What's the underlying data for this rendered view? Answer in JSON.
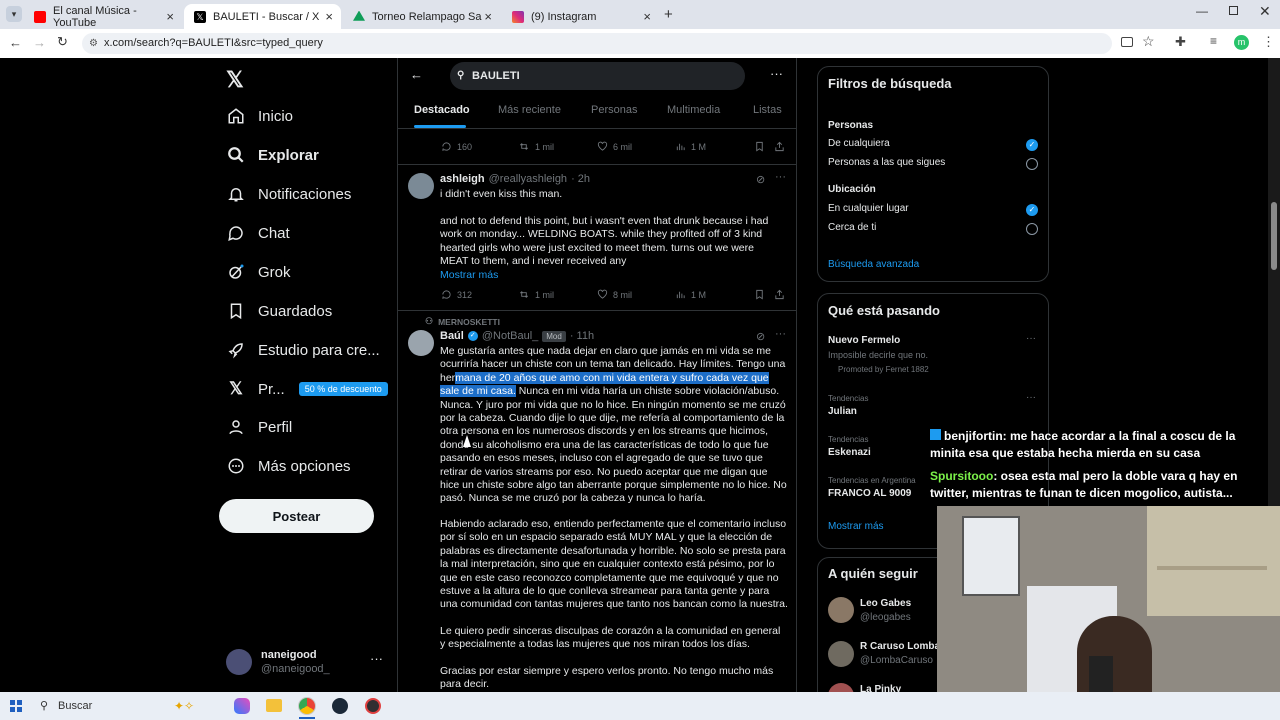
{
  "browser": {
    "tabs": [
      {
        "label": "El canal Música - YouTube",
        "color": "#ff0000"
      },
      {
        "label": "BAULETI - Buscar / X",
        "color": "#000000"
      },
      {
        "label": "Torneo Relampago Sanzi - Goo",
        "color": "#0f9d58"
      },
      {
        "label": "(9) Instagram",
        "color": "#e1306c"
      }
    ],
    "url": "x.com/search?q=BAULETI&src=typed_query",
    "profile_initial": "m"
  },
  "nav": {
    "items": [
      {
        "label": "Inicio",
        "icon": "home-icon"
      },
      {
        "label": "Explorar",
        "icon": "search-icon"
      },
      {
        "label": "Notificaciones",
        "icon": "bell-icon"
      },
      {
        "label": "Chat",
        "icon": "chat-icon"
      },
      {
        "label": "Grok",
        "icon": "grok-icon"
      },
      {
        "label": "Guardados",
        "icon": "bookmark-icon"
      },
      {
        "label": "Estudio para cre...",
        "icon": "rocket-icon"
      },
      {
        "label": "Pr...",
        "icon": "x-icon"
      },
      {
        "label": "Perfil",
        "icon": "person-icon"
      },
      {
        "label": "Más opciones",
        "icon": "more-circle-icon"
      }
    ],
    "premium_badge": "50 % de descuento",
    "post_button": "Postear",
    "account": {
      "name": "naneigood",
      "handle": "@naneigood_"
    }
  },
  "search": {
    "query": "BAULETI",
    "tabs": [
      "Destacado",
      "Más reciente",
      "Personas",
      "Multimedia",
      "Listas"
    ]
  },
  "posts": [
    {
      "stats": {
        "replies": "160",
        "reposts": "1 mil",
        "likes": "6 mil",
        "views": "1 M"
      }
    },
    {
      "author": "ashleigh",
      "handle": "@reallyashleigh",
      "time": "· 2h",
      "text1": "i didn't even kiss this man.",
      "text2": "and not to defend this point, but i wasn't even that drunk because i had work on monday... WELDING BOATS. while they profited off of 3 kind hearted girls who were just excited to meet them. turns out we were MEAT to them, and i never received any",
      "show_more": "Mostrar más",
      "stats": {
        "replies": "312",
        "reposts": "1 mil",
        "likes": "8 mil",
        "views": "1 M"
      }
    },
    {
      "context": "MERNOSKETTI",
      "author": "Baúl",
      "handle": "@NotBaul_",
      "badge": "Mod",
      "time": "· 11h",
      "p1_before": "Me gustaría antes que nada dejar en claro que jamás en mi vida se me ocurriría hacer un chiste con un tema tan delicado. Hay límites. Tengo una her",
      "p1_highlight": "mana de 20 años que amo con mi vida entera y sufro cada vez que sale de mi casa.",
      "p1_after": " Nunca en mi vida haría un chiste sobre violación/abuso. Nunca. Y juro por mi vida que no lo hice. En ningún momento se me cruzó por la cabeza. Cuando dije lo que dije, me refería al comportamiento de la otra persona en los numerosos discords y en los streams que hicimos, donde su alcoholismo era una de las características de todo lo que fue pasando en esos meses, incluso con el agregado de que se tuvo que retirar de varios streams por eso. No puedo aceptar que me digan que hice un chiste sobre algo tan aberrante porque simplemente no lo hice. No pasó. Nunca se me cruzó por la cabeza y nunca lo haría.",
      "p2": "Habiendo aclarado eso, entiendo perfectamente que el comentario incluso por sí solo en un espacio separado está MUY MAL y que la elección de palabras es directamente desafortunada y horrible. No solo se presta para la mal interpretación, sino que en cualquier contexto está pésimo, por lo que en este caso reconozco completamente que me equivoqué y que no estuve a la altura de lo que conlleva streamear para tanta gente y para una comunidad con tantas mujeres que tanto nos bancan como la nuestra.",
      "p3": "Le quiero pedir sinceras disculpas de corazón a la comunidad en general y especialmente a todas las mujeres que nos miran todos los días.",
      "p4": "Gracias por estar siempre y espero verlos pronto. No tengo mucho más para decir."
    }
  ],
  "filters": {
    "title": "Filtros de búsqueda",
    "people_label": "Personas",
    "people_opt1": "De cualquiera",
    "people_opt2": "Personas a las que sigues",
    "location_label": "Ubicación",
    "loc_opt1": "En cualquier lugar",
    "loc_opt2": "Cerca de ti",
    "advanced": "Búsqueda avanzada"
  },
  "trends": {
    "title": "Qué está pasando",
    "items": [
      {
        "name": "Nuevo Fermelo",
        "sub": "Imposible decirle que no.",
        "promo": "Promoted by Fernet 1882"
      },
      {
        "category": "Tendencias",
        "name": "Julian"
      },
      {
        "category": "Tendencias",
        "name": "Eskenazi"
      },
      {
        "category": "Tendencias en Argentina",
        "name": "FRANCO AL 9009"
      }
    ],
    "show_more": "Mostrar más"
  },
  "follow": {
    "title": "A quién seguir",
    "items": [
      {
        "name": "Leo Gabes",
        "handle": "@leogabes"
      },
      {
        "name": "R Caruso Lomba",
        "handle": "@LombaCaruso"
      },
      {
        "name": "La Pinky",
        "handle": ""
      }
    ]
  },
  "chat_overlay": [
    {
      "user": "benjifortin",
      "message": ": me hace acordar a la final a coscu de la minita esa que estaba hecha mierda en su casa",
      "user_color": "#ffffff"
    },
    {
      "user": "Spursitooo",
      "message": ": osea esta mal pero la doble vara q hay en twitter, mientras te funan te dicen mogolico, autista...",
      "user_color": "#7cf24a"
    }
  ],
  "taskbar": {
    "search_placeholder": "Buscar"
  },
  "colors": {
    "accent": "#1d9bf0",
    "highlight": "#1d6ec8"
  }
}
